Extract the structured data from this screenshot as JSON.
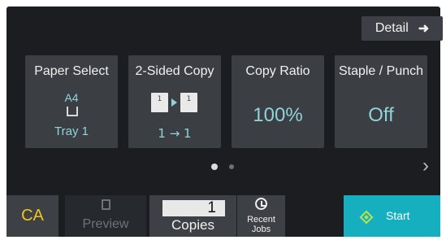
{
  "header": {
    "detail_label": "Detail",
    "detail_arrow": "➜"
  },
  "tiles": [
    {
      "title": "Paper Select",
      "paper_size": "A4",
      "tray": "Tray 1"
    },
    {
      "title": "2-Sided Copy",
      "page_left": "1",
      "page_right": "1",
      "mode": "1 → 1"
    },
    {
      "title": "Copy Ratio",
      "value": "100%"
    },
    {
      "title": "Staple / Punch",
      "value": "Off"
    }
  ],
  "pager": {
    "current_page": 1,
    "total_pages": 2,
    "next_arrow": "›"
  },
  "bottom": {
    "ca_label": "CA",
    "preview_label": "Preview",
    "copies_value": "1",
    "copies_label": "Copies",
    "recent_line1": "Recent",
    "recent_line2": "Jobs",
    "start_label": "Start"
  },
  "colors": {
    "accent": "#8fd3db",
    "ca": "#f0c419",
    "start_bg": "#16afc0",
    "start_icon": "#b7e34a"
  }
}
